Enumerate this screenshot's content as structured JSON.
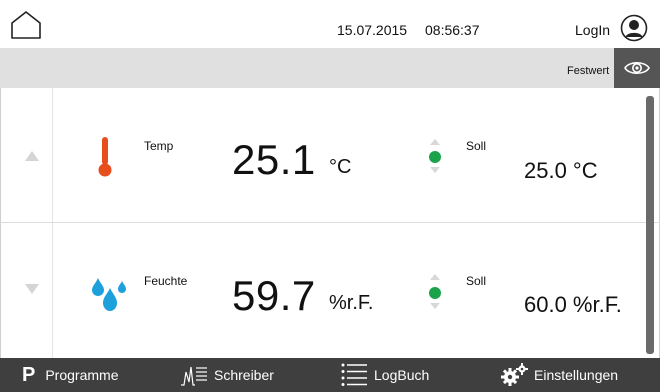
{
  "header": {
    "date": "15.07.2015",
    "time": "08:56:37",
    "login_label": "LogIn"
  },
  "toolbar": {
    "mode_label": "Festwert"
  },
  "rows": [
    {
      "name": "Temp",
      "value": "25.1",
      "unit": "°C",
      "setpoint_label": "Soll",
      "setpoint_value": "25.0 °C",
      "icon": "thermometer-icon",
      "icon_color": "#e84e1b",
      "status_color": "#1aa34a"
    },
    {
      "name": "Feuchte",
      "value": "59.7",
      "unit": "%r.F.",
      "setpoint_label": "Soll",
      "setpoint_value": "60.0 %r.F.",
      "icon": "water-drops-icon",
      "icon_color": "#1ea0dc",
      "status_color": "#1aa34a"
    }
  ],
  "bottom_nav": {
    "programme": {
      "icon_letter": "P",
      "label": "Programme"
    },
    "schreiber": {
      "label": "Schreiber"
    },
    "logbuch": {
      "label": "LogBuch"
    },
    "einstellungen": {
      "label": "Einstellungen"
    }
  },
  "colors": {
    "bottom_bar": "#3f3f3f",
    "strip": "#e0e0e0",
    "eye_button": "#555555"
  }
}
